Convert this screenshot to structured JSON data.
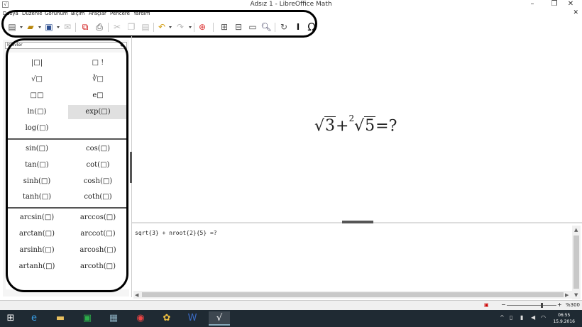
{
  "window": {
    "title": "Adsız 1 - LibreOffice Math",
    "min": "–",
    "restore": "❐",
    "close": "✕",
    "doc_close": "✕"
  },
  "menu": [
    "Dosya",
    "Düzenle",
    "Görünüm",
    "Biçim",
    "Araçlar",
    "Pencere",
    "Yardım"
  ],
  "toolbar_icons": [
    "new-icon",
    "open-icon",
    "save-icon",
    "email-icon",
    "export-pdf-icon",
    "print-icon",
    "cut-icon",
    "copy-icon",
    "paste-icon",
    "undo-icon",
    "redo-icon",
    "help-icon",
    "zoom-in-icon",
    "zoom-out-icon",
    "show-all-icon",
    "zoom-icon",
    "update-icon",
    "formula-cursor-icon",
    "symbols-icon"
  ],
  "toolbar_glyphs": {
    "new": "▤",
    "open": "▰",
    "save": "▣",
    "email": "✉",
    "pdf": "⧉",
    "print": "⎙",
    "cut": "✂",
    "copy": "❐",
    "paste": "▤",
    "undo": "↶",
    "redo": "↷",
    "help": "⊕",
    "zoom_in": "⊞",
    "zoom_out": "⊟",
    "show_all": "▭",
    "zoom": "🔍︎",
    "update": "↻",
    "cursor": "I",
    "symbols": "Ω"
  },
  "elements_panel": {
    "category": "İşlevler",
    "groups": [
      [
        "|□|",
        "□ !",
        "√□",
        "∛□",
        "□□",
        "e□",
        "ln(□)",
        "exp(□)",
        "log(□)"
      ],
      [
        "sin(□)",
        "cos(□)",
        "tan(□)",
        "cot(□)",
        "sinh(□)",
        "cosh(□)",
        "tanh(□)",
        "coth(□)"
      ],
      [
        "arcsin(□)",
        "arccos(□)",
        "arctan(□)",
        "arccot(□)",
        "arsinh(□)",
        "arcosh(□)",
        "artanh(□)",
        "arcoth(□)"
      ]
    ]
  },
  "formula": {
    "radical1": "√",
    "radicand1": "3",
    "plus": "+",
    "index": "2",
    "radical2": "√",
    "radicand2": "5",
    "equals": "=",
    "result": "?"
  },
  "editor": {
    "text": "sqrt{3} + nroot{2}{5} =?"
  },
  "statusbar": {
    "zoom": "%300"
  },
  "taskbar": {
    "apps": [
      "start-icon",
      "ie-icon",
      "explorer-icon",
      "store-icon",
      "control-panel-icon",
      "chrome-icon",
      "paint-icon",
      "word-icon",
      "libreoffice-math-icon"
    ],
    "time": "06:55",
    "date": "15.9.2016"
  }
}
